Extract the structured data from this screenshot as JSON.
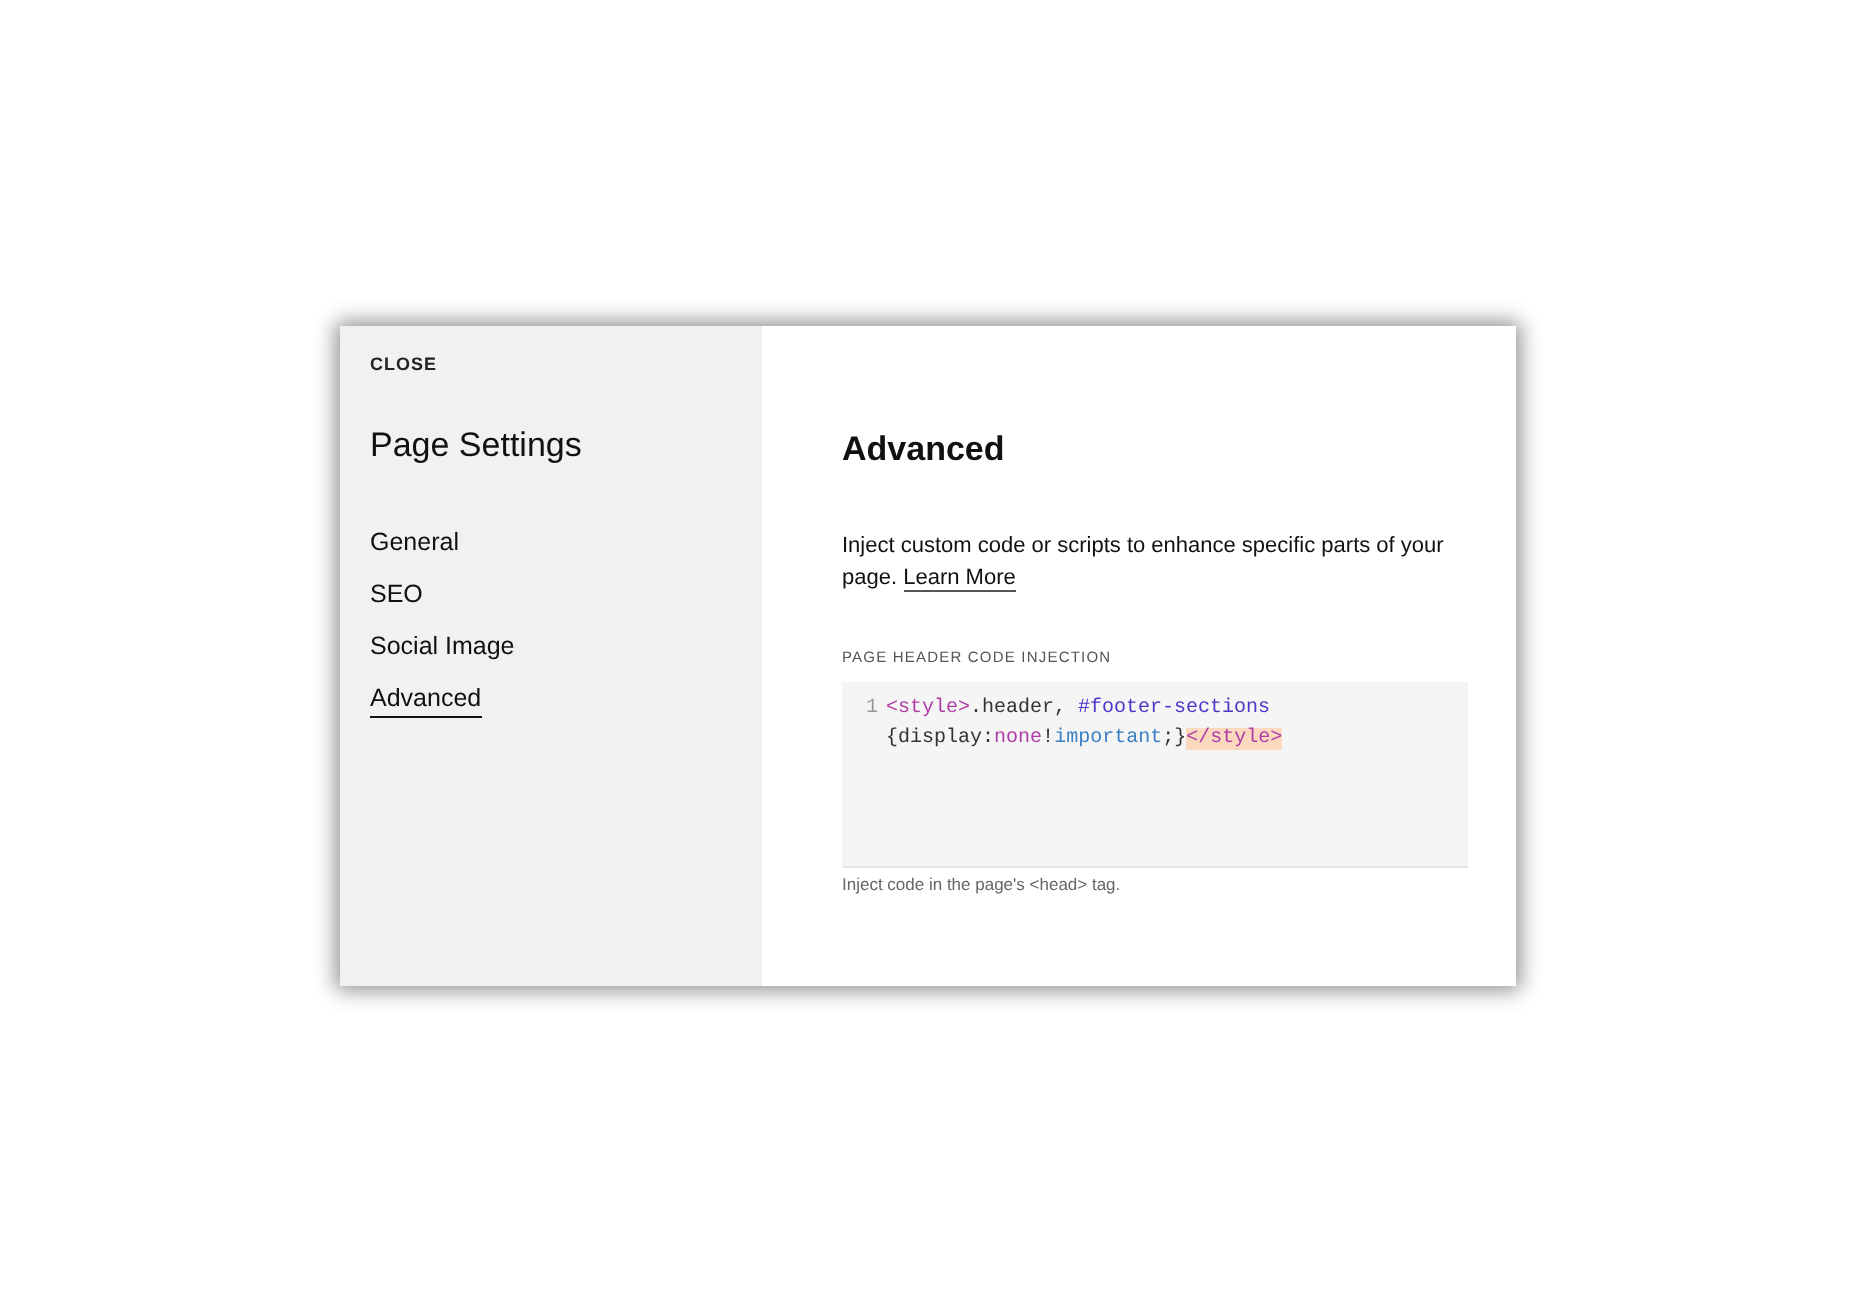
{
  "sidebar": {
    "close": "CLOSE",
    "title": "Page Settings",
    "items": [
      {
        "label": "General",
        "selected": false
      },
      {
        "label": "SEO",
        "selected": false
      },
      {
        "label": "Social Image",
        "selected": false
      },
      {
        "label": "Advanced",
        "selected": true
      }
    ]
  },
  "main": {
    "heading": "Advanced",
    "description": "Inject custom code or scripts to enhance specific parts of your page.",
    "link": "Learn More",
    "field_label": "PAGE HEADER CODE INJECTION",
    "code": {
      "line_number": "1",
      "tokens": [
        {
          "kind": "tag",
          "text": "<style>"
        },
        {
          "kind": "plain",
          "text": ".header, "
        },
        {
          "kind": "selector",
          "text": "#footer-sections"
        },
        {
          "kind": "plain",
          "text": " {display:"
        },
        {
          "kind": "value",
          "text": "none"
        },
        {
          "kind": "plain",
          "text": "!"
        },
        {
          "kind": "keyword",
          "text": "important"
        },
        {
          "kind": "plain",
          "text": ";}"
        },
        {
          "kind": "matched-tag",
          "text": "</style>"
        }
      ]
    },
    "hint": "Inject code in the page's <head> tag."
  }
}
